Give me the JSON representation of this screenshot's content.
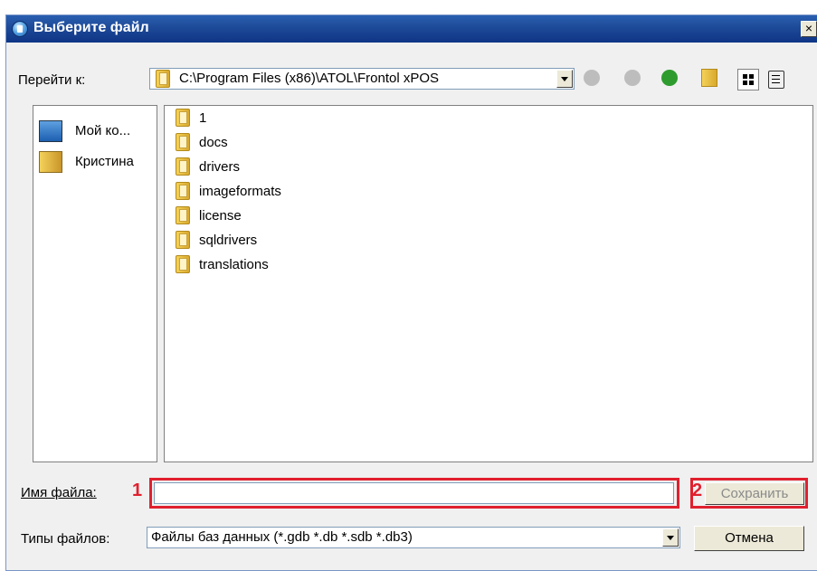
{
  "window": {
    "title": "Выберите файл",
    "close_label": "×"
  },
  "lookin": {
    "label": "Перейти к:",
    "path": "C:\\Program Files (x86)\\ATOL\\Frontol xPOS"
  },
  "toolbar": {
    "icons": [
      "back-icon",
      "forward-icon",
      "up-folder-icon",
      "new-folder-icon",
      "list-view-icon",
      "detail-view-icon"
    ]
  },
  "places": [
    {
      "label": "Мой ко...",
      "icon": "my-computer-icon"
    },
    {
      "label": "Кристина",
      "icon": "user-folder-icon"
    }
  ],
  "files": [
    {
      "name": "1"
    },
    {
      "name": "docs"
    },
    {
      "name": "drivers"
    },
    {
      "name": "imageformats"
    },
    {
      "name": "license"
    },
    {
      "name": "sqldrivers"
    },
    {
      "name": "translations"
    }
  ],
  "filename": {
    "label": "Имя файла:",
    "value": "",
    "annotation": "1"
  },
  "filetype": {
    "label": "Типы файлов:",
    "value": "Файлы баз данных (*.gdb *.db *.sdb *.db3)"
  },
  "buttons": {
    "save": "Сохранить",
    "save_annotation": "2",
    "cancel": "Отмена"
  },
  "colors": {
    "titlebar": "#1d4a98",
    "annotation": "#e0202e"
  }
}
